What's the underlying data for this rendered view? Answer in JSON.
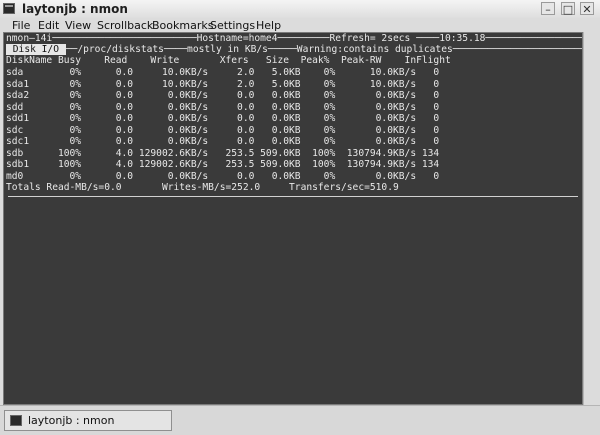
{
  "window": {
    "title": "laytonjb : nmon",
    "minimize_glyph": "–",
    "maximize_glyph": "□",
    "close_glyph": "✕",
    "icon": "terminal-icon"
  },
  "menu": {
    "items": [
      "File",
      "Edit",
      "View",
      "Scrollback",
      "Bookmarks",
      "Settings",
      "Help"
    ]
  },
  "terminal": {
    "header_line": "nmon–14i─────────────────────────Hostname=home4─────────Refresh= 2secs ────10:35.18──────────────────────────",
    "tab_label": " Disk I/O ",
    "sub_line_rest": "──/proc/diskstats────mostly in KB/s─────Warning:contains duplicates──────────────────────────────",
    "column_header": "DiskName Busy    Read    Write       Xfers   Size  Peak%  Peak-RW    InFlight",
    "rows": [
      "sda        0%      0.0     10.0KB/s     2.0   5.0KB    0%      10.0KB/s   0",
      "sda1       0%      0.0     10.0KB/s     2.0   5.0KB    0%      10.0KB/s   0",
      "sda2       0%      0.0      0.0KB/s     0.0   0.0KB    0%       0.0KB/s   0",
      "sdd        0%      0.0      0.0KB/s     0.0   0.0KB    0%       0.0KB/s   0",
      "sdd1       0%      0.0      0.0KB/s     0.0   0.0KB    0%       0.0KB/s   0",
      "sdc        0%      0.0      0.0KB/s     0.0   0.0KB    0%       0.0KB/s   0",
      "sdc1       0%      0.0      0.0KB/s     0.0   0.0KB    0%       0.0KB/s   0",
      "sdb      100%      4.0 129002.6KB/s   253.5 509.0KB  100%  130794.9KB/s 134",
      "sdb1     100%      4.0 129002.6KB/s   253.5 509.0KB  100%  130794.9KB/s 134",
      "md0        0%      0.0      0.0KB/s     0.0   0.0KB    0%       0.0KB/s   0"
    ],
    "totals_line": "Totals Read-MB/s=0.0       Writes-MB/s=252.0     Transfers/sec=510.9"
  },
  "taskbar": {
    "task_label": "laytonjb : nmon",
    "icon": "terminal-icon"
  }
}
